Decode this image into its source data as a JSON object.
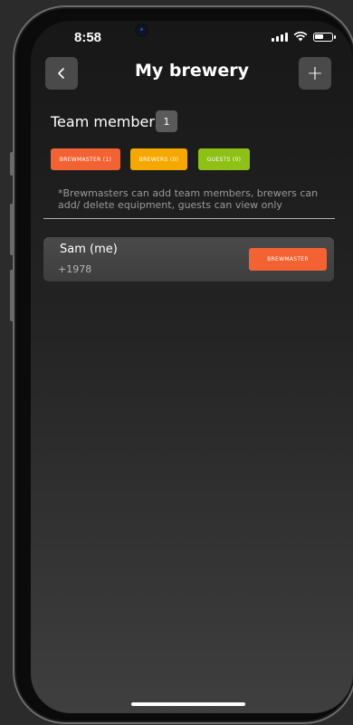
{
  "status_bar": {
    "time": "8:58"
  },
  "header": {
    "title": "My brewery",
    "back_icon": "chevron-left-icon",
    "add_label": "+"
  },
  "team": {
    "title": "Team members",
    "count": "1",
    "chips": {
      "brewmaster": "BREWMASTER (1)",
      "brewers": "BREWERS (0)",
      "guests": "GUESTS (0)"
    },
    "note": "*Brewmasters can add team members, brewers can add/ delete equipment, guests can view only"
  },
  "members": [
    {
      "name": "Sam (me)",
      "phone": "+1978",
      "role": "BREWMASTER"
    }
  ],
  "colors": {
    "brewmaster": "#f26232",
    "brewers": "#f5a800",
    "guests": "#8ec016"
  }
}
